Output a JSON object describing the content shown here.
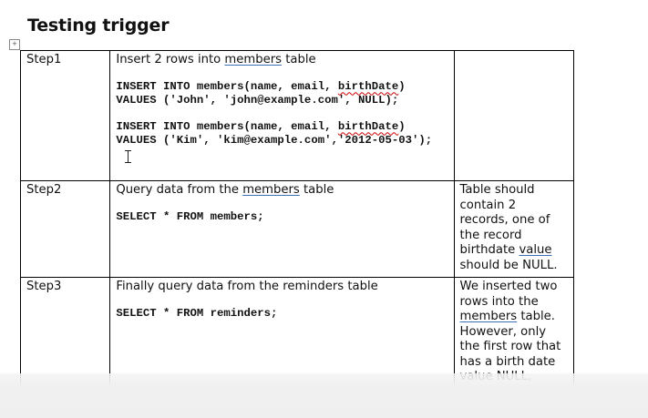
{
  "document": {
    "heading": "Testing trigger",
    "table_handle_icon": "table-move-handle-icon",
    "rows": [
      {
        "step": "Step1",
        "description_parts": [
          "Insert 2 rows into ",
          "members",
          " table"
        ],
        "code_blocks": [
          [
            "INSERT INTO members(name, email, ",
            "birthDate",
            ")",
            "VALUES ('John', 'john@example.com', NULL);"
          ],
          [
            "INSERT INTO members(name, email, ",
            "birthDate",
            ")",
            "VALUES ('Kim', 'kim@example.com','2012-05-03');"
          ]
        ],
        "expected": ""
      },
      {
        "step": "Step2",
        "description_parts": [
          "Query data from the ",
          "members",
          " table"
        ],
        "code": "SELECT * FROM members;",
        "expected_parts": [
          "Table should contain 2 records, one of the record birthdate ",
          "value",
          " should be NULL."
        ]
      },
      {
        "step": "Step3",
        "description": "Finally query data from the reminders table",
        "code": "SELECT * FROM reminders;",
        "expected_parts": [
          "We inserted two rows into the ",
          "members",
          " table. However, only the first row that has a birth date value NULL, therefore the"
        ]
      }
    ]
  }
}
